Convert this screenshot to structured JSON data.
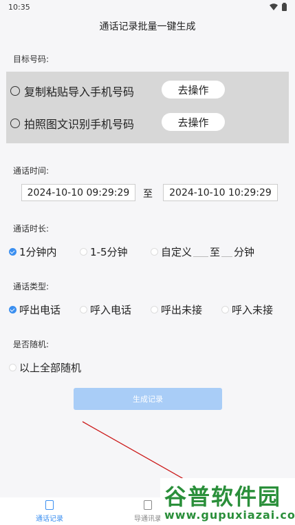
{
  "status": {
    "time": "10:35"
  },
  "title": "通话记录批量一键生成",
  "target": {
    "label": "目标号码:",
    "options": [
      {
        "label": "复制粘贴导入手机号码",
        "button": "去操作"
      },
      {
        "label": "拍照图文识别手机号码",
        "button": "去操作"
      }
    ]
  },
  "time": {
    "label": "通话时间:",
    "start": "2024-10-10 09:29:29",
    "separator": "至",
    "end": "2024-10-10 10:29:29"
  },
  "duration": {
    "label": "通话时长:",
    "options": [
      "1分钟内",
      "1-5分钟",
      "自定义",
      "至",
      "分钟"
    ],
    "selected": 0
  },
  "call_type": {
    "label": "通话类型:",
    "options": [
      "呼出电话",
      "呼入电话",
      "呼出未接",
      "呼入未接"
    ],
    "selected": 0
  },
  "random": {
    "label": "是否随机:",
    "option": "以上全部随机"
  },
  "generate_button": "生成记录",
  "nav": {
    "items": [
      "通话记录",
      "导通讯录"
    ]
  },
  "watermark": {
    "title": "谷普软件园",
    "url": "www.gupuxiazai.com"
  },
  "colors": {
    "accent": "#3b8ff0",
    "button_light": "#a9cdf7",
    "panel": "#d7d7d7",
    "annotation": "#cc1a1a"
  }
}
